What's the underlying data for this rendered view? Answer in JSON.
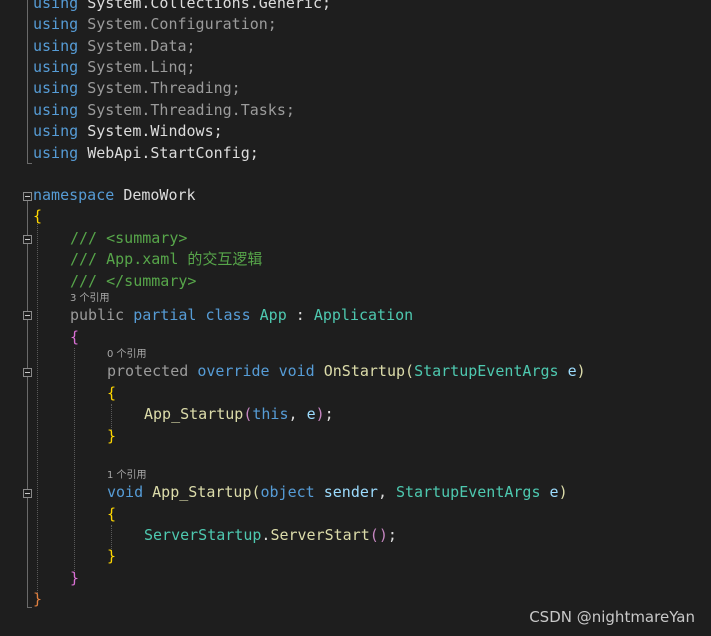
{
  "editor": {
    "usings": [
      "System.Collections.Generic;",
      "System.Configuration;",
      "System.Data;",
      "System.Linq;",
      "System.Threading;",
      "System.Threading.Tasks;",
      "System.Windows;",
      "WebApi.StartConfig;"
    ],
    "using_keyword": "using",
    "namespace_keyword": "namespace",
    "namespace_name": "DemoWork",
    "open_brace": "{",
    "close_brace": "}",
    "doc_summary_open": "/// <summary>",
    "doc_summary_text": "/// App.xaml 的交互逻辑",
    "doc_summary_close": "/// </summary>",
    "class_lens": "3 个引用",
    "class_modifier_public": "public",
    "class_modifier_partial": "partial",
    "class_keyword": "class",
    "class_name": "App",
    "colon": ":",
    "base_class": "Application",
    "method1_lens": "0 个引用",
    "method1_protected": "protected",
    "method1_override": "override",
    "method1_void": "void",
    "method1_name": "OnStartup",
    "method1_param_type": "StartupEventArgs",
    "method1_param_name": "e",
    "call1_name": "App_Startup",
    "call1_arg1": "this",
    "call1_arg2": "e",
    "method2_lens": "1 个引用",
    "method2_void": "void",
    "method2_name": "App_Startup",
    "method2_param1_type": "object",
    "method2_param1_name": "sender",
    "method2_param2_type": "StartupEventArgs",
    "method2_param2_name": "e",
    "call2_class": "ServerStartup",
    "call2_method": "ServerStart",
    "paren_open": "(",
    "paren_close": ")",
    "comma": ",",
    "semicolon": ";",
    "dot": "."
  },
  "watermark": "CSDN @nightmareYan"
}
